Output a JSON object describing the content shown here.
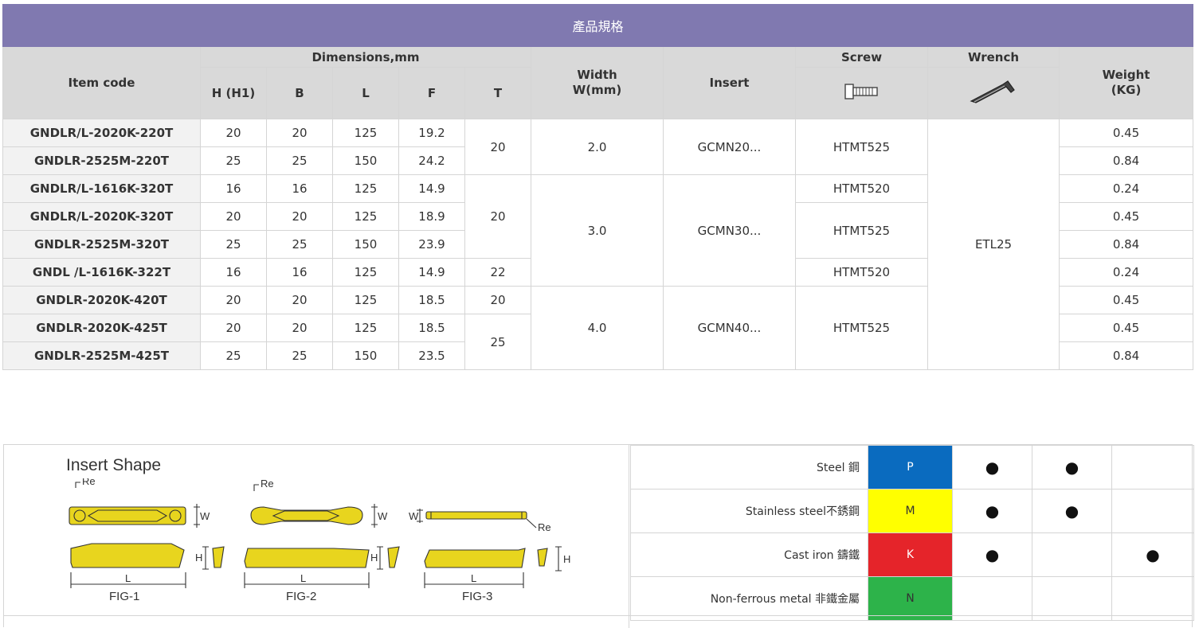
{
  "spec_table": {
    "title": "產品規格",
    "headers": {
      "item_code": "Item code",
      "dimensions": "Dimensions,mm",
      "width_line1": "Width",
      "width_line2": "W(mm)",
      "insert": "Insert",
      "screw": "Screw",
      "wrench": "Wrench",
      "weight_line1": "Weight",
      "weight_line2": "(KG)",
      "dim_cols": [
        "H (H1)",
        "B",
        "L",
        "F",
        "T"
      ]
    },
    "rows": [
      {
        "code": "GNDLR/L-2020K-220T",
        "h": "20",
        "b": "20",
        "l": "125",
        "f": "19.2",
        "weight": "0.45"
      },
      {
        "code": "GNDLR-2525M-220T",
        "h": "25",
        "b": "25",
        "l": "150",
        "f": "24.2",
        "weight": "0.84"
      },
      {
        "code": "GNDLR/L-1616K-320T",
        "h": "16",
        "b": "16",
        "l": "125",
        "f": "14.9",
        "weight": "0.24"
      },
      {
        "code": "GNDLR/L-2020K-320T",
        "h": "20",
        "b": "20",
        "l": "125",
        "f": "18.9",
        "weight": "0.45"
      },
      {
        "code": "GNDLR-2525M-320T",
        "h": "25",
        "b": "25",
        "l": "150",
        "f": "23.9",
        "weight": "0.84"
      },
      {
        "code": "GNDL /L-1616K-322T",
        "h": "16",
        "b": "16",
        "l": "125",
        "f": "14.9",
        "weight": "0.24"
      },
      {
        "code": "GNDLR-2020K-420T",
        "h": "20",
        "b": "20",
        "l": "125",
        "f": "18.5",
        "weight": "0.45"
      },
      {
        "code": "GNDLR-2020K-425T",
        "h": "20",
        "b": "20",
        "l": "125",
        "f": "18.5",
        "weight": "0.45"
      },
      {
        "code": "GNDLR-2525M-425T",
        "h": "25",
        "b": "25",
        "l": "150",
        "f": "23.5",
        "weight": "0.84"
      }
    ],
    "t_groups": [
      "20",
      "20",
      "22",
      "20",
      "25"
    ],
    "width_groups": [
      "2.0",
      "3.0",
      "4.0"
    ],
    "insert_groups": [
      "GCMN20...",
      "GCMN30...",
      "GCMN40..."
    ],
    "screw_groups": [
      "HTMT525",
      "HTMT520",
      "HTMT525",
      "HTMT520",
      "HTMT525"
    ],
    "wrench": "ETL25"
  },
  "insert_shape": {
    "title": "Insert Shape",
    "figs": [
      "FIG-1",
      "FIG-2",
      "FIG-3"
    ],
    "dim_labels": {
      "re": "Re",
      "w": "W",
      "h": "H",
      "l": "L"
    }
  },
  "materials": [
    {
      "name": "Steel 鋼",
      "code": "P",
      "color": "#0a6bbf",
      "text_color": "#ffffff",
      "dots": [
        true,
        true,
        false
      ]
    },
    {
      "name": "Stainless steel不銹鋼",
      "code": "M",
      "color": "#ffff00",
      "text_color": "#333333",
      "dots": [
        true,
        true,
        false
      ]
    },
    {
      "name": "Cast iron 鑄鐵",
      "code": "K",
      "color": "#e5242a",
      "text_color": "#ffffff",
      "dots": [
        true,
        false,
        true
      ]
    },
    {
      "name": "Non-ferrous metal 非鐵金屬",
      "code": "N",
      "color": "#2db34a",
      "text_color": "#333333",
      "dots": [
        false,
        false,
        false
      ]
    }
  ],
  "icons": {
    "screw": "screw-icon",
    "wrench": "hex-wrench-icon"
  }
}
